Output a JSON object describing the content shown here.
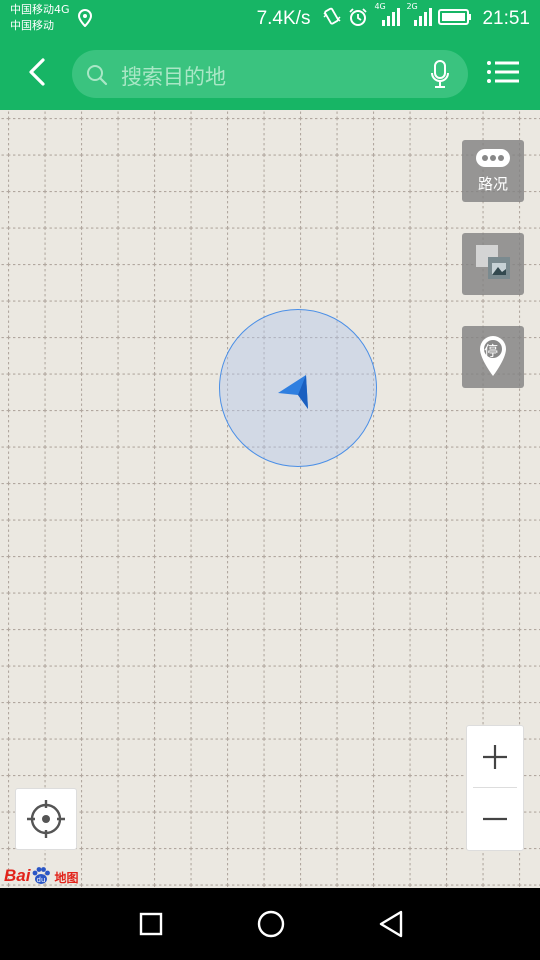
{
  "status_bar": {
    "carrier_1": "中国移动4G",
    "carrier_2": "中国移动",
    "network_speed": "7.4K/s",
    "sim1_tech": "4G",
    "sim2_tech": "2G",
    "time": "21:51",
    "icons": [
      "location-icon",
      "vibrate-icon",
      "alarm-icon",
      "signal-icon",
      "signal-icon",
      "battery-icon"
    ]
  },
  "header": {
    "search_placeholder": "搜索目的地",
    "icons": [
      "back-arrow-icon",
      "search-icon",
      "microphone-icon",
      "menu-icon"
    ]
  },
  "map": {
    "traffic_label": "路况",
    "parking_glyph": "停",
    "zoom_in": "+",
    "zoom_out": "−",
    "logo_text_1": "Bai",
    "logo_text_2": "地图",
    "accent_color": "#17b565",
    "location_color": "#2f7fe0"
  },
  "nav_bar": {
    "icons": [
      "recent-apps-icon",
      "home-icon",
      "back-icon"
    ]
  }
}
